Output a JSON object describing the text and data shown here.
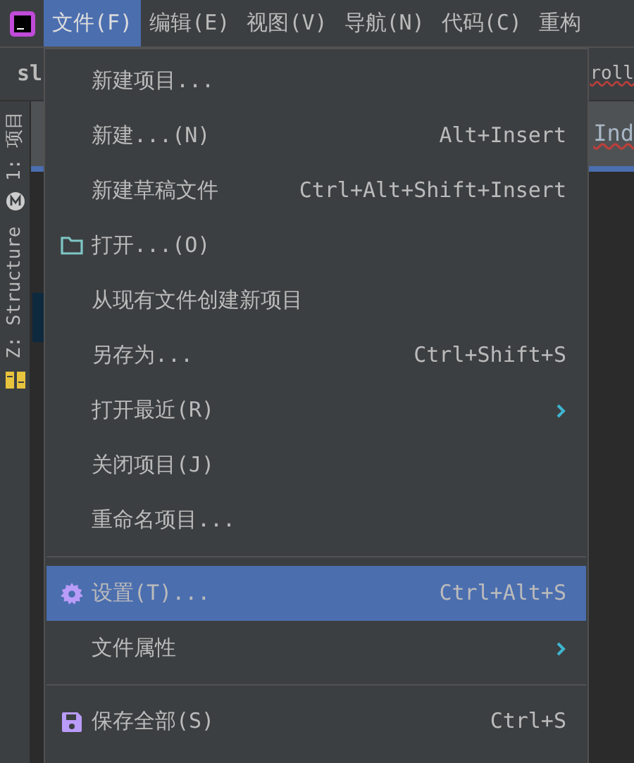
{
  "menubar": [
    {
      "label": "文件(F)",
      "selected": true
    },
    {
      "label": "编辑(E)",
      "selected": false
    },
    {
      "label": "视图(V)",
      "selected": false
    },
    {
      "label": "导航(N)",
      "selected": false
    },
    {
      "label": "代码(C)",
      "selected": false
    },
    {
      "label": "重构",
      "selected": false
    }
  ],
  "editor_tab": {
    "label": "sl"
  },
  "editor": {
    "line_1": "roll",
    "line_2": "Ind"
  },
  "tool_strip": [
    {
      "label": "1: 项目",
      "selected": false
    },
    {
      "label": "Z: Structure",
      "selected": false
    }
  ],
  "menu": {
    "items": [
      {
        "kind": "item",
        "label": "新建项目...",
        "selected": false
      },
      {
        "kind": "item",
        "label": "新建...(N)",
        "shortcut": "Alt+Insert",
        "selected": false
      },
      {
        "kind": "item",
        "label": "新建草稿文件",
        "shortcut": "Ctrl+Alt+Shift+Insert",
        "selected": false
      },
      {
        "kind": "folder",
        "label": "打开...(O)",
        "selected": false
      },
      {
        "kind": "item",
        "label": "从现有文件创建新项目",
        "selected": false
      },
      {
        "kind": "item",
        "label": "另存为...",
        "shortcut": "Ctrl+Shift+S",
        "selected": false
      },
      {
        "kind": "item",
        "label": "打开最近(R)",
        "submenu": true,
        "selected": false
      },
      {
        "kind": "item",
        "label": "关闭项目(J)",
        "selected": false
      },
      {
        "kind": "item",
        "label": "重命名项目...",
        "selected": false
      },
      {
        "kind": "separator"
      },
      {
        "kind": "settings",
        "label": "设置(T)...",
        "shortcut": "Ctrl+Alt+S",
        "selected": true
      },
      {
        "kind": "item",
        "label": "文件属性",
        "submenu": true,
        "selected": false
      },
      {
        "kind": "separator"
      },
      {
        "kind": "save",
        "label": "保存全部(S)",
        "shortcut": "Ctrl+S",
        "selected": false
      }
    ]
  }
}
